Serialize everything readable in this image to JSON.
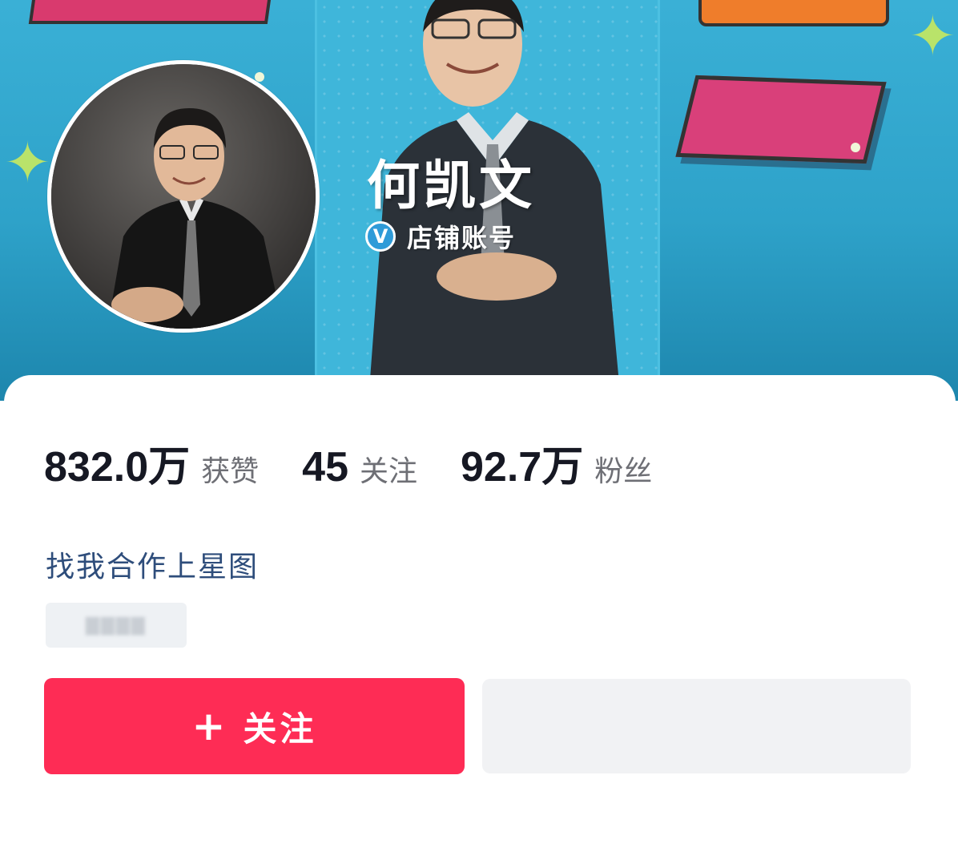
{
  "profile": {
    "display_name": "何凯文",
    "badge_label": "店铺账号",
    "badge_icon": "verified-v-icon"
  },
  "stats": [
    {
      "value": "832.0万",
      "label": "获赞"
    },
    {
      "value": "45",
      "label": "关注"
    },
    {
      "value": "92.7万",
      "label": "粉丝"
    }
  ],
  "cooperation_link": "找我合作上星图",
  "actions": {
    "follow_plus": "+",
    "follow_label": "关注"
  },
  "colors": {
    "follow_button": "#fe2c55",
    "banner": "#3ab0d6",
    "link": "#2e4d7b"
  }
}
